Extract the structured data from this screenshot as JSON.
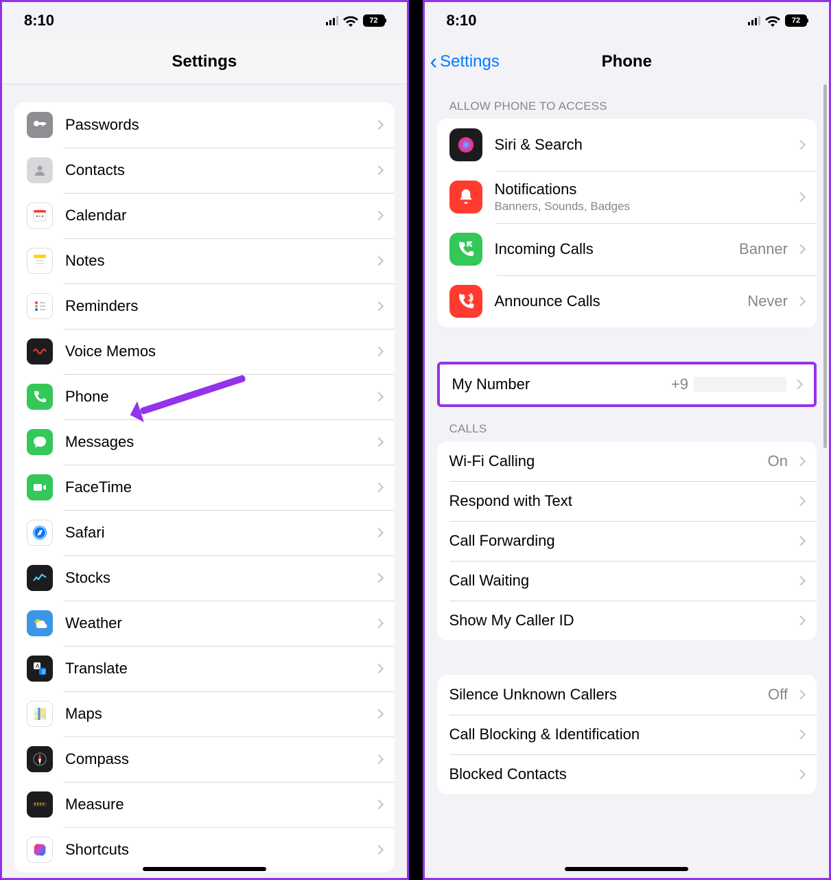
{
  "left": {
    "time": "8:10",
    "battery": "72",
    "title": "Settings",
    "items": [
      {
        "label": "Passwords",
        "icon": "key-icon",
        "bg": "#8e8e93"
      },
      {
        "label": "Contacts",
        "icon": "contacts-icon",
        "bg": "#d8d8dc"
      },
      {
        "label": "Calendar",
        "icon": "calendar-icon",
        "bg": "#ffffff"
      },
      {
        "label": "Notes",
        "icon": "notes-icon",
        "bg": "#ffffff"
      },
      {
        "label": "Reminders",
        "icon": "reminders-icon",
        "bg": "#ffffff"
      },
      {
        "label": "Voice Memos",
        "icon": "voice-memos-icon",
        "bg": "#1c1c1e"
      },
      {
        "label": "Phone",
        "icon": "phone-icon",
        "bg": "#34c759",
        "annotate": true
      },
      {
        "label": "Messages",
        "icon": "messages-icon",
        "bg": "#34c759"
      },
      {
        "label": "FaceTime",
        "icon": "facetime-icon",
        "bg": "#34c759"
      },
      {
        "label": "Safari",
        "icon": "safari-icon",
        "bg": "#ffffff"
      },
      {
        "label": "Stocks",
        "icon": "stocks-icon",
        "bg": "#1c1c1e"
      },
      {
        "label": "Weather",
        "icon": "weather-icon",
        "bg": "#3a97e8"
      },
      {
        "label": "Translate",
        "icon": "translate-icon",
        "bg": "#1c1c1e"
      },
      {
        "label": "Maps",
        "icon": "maps-icon",
        "bg": "#ffffff"
      },
      {
        "label": "Compass",
        "icon": "compass-icon",
        "bg": "#1c1c1e"
      },
      {
        "label": "Measure",
        "icon": "measure-icon",
        "bg": "#1c1c1e"
      },
      {
        "label": "Shortcuts",
        "icon": "shortcuts-icon",
        "bg": "#ffffff"
      }
    ]
  },
  "right": {
    "time": "8:10",
    "battery": "72",
    "back": "Settings",
    "title": "Phone",
    "access_header": "ALLOW PHONE TO ACCESS",
    "access": [
      {
        "label": "Siri & Search",
        "icon": "siri-icon",
        "bg": "#1c1c1e"
      },
      {
        "label": "Notifications",
        "sub": "Banners, Sounds, Badges",
        "icon": "bell-icon",
        "bg": "#ff3b30"
      },
      {
        "label": "Incoming Calls",
        "detail": "Banner",
        "icon": "incoming-icon",
        "bg": "#34c759"
      },
      {
        "label": "Announce Calls",
        "detail": "Never",
        "icon": "announce-icon",
        "bg": "#ff3b30"
      }
    ],
    "my_number": {
      "label": "My Number",
      "value": "+9"
    },
    "calls_header": "CALLS",
    "calls": [
      {
        "label": "Wi-Fi Calling",
        "detail": "On"
      },
      {
        "label": "Respond with Text"
      },
      {
        "label": "Call Forwarding"
      },
      {
        "label": "Call Waiting"
      },
      {
        "label": "Show My Caller ID"
      }
    ],
    "extra": [
      {
        "label": "Silence Unknown Callers",
        "detail": "Off"
      },
      {
        "label": "Call Blocking & Identification"
      },
      {
        "label": "Blocked Contacts"
      }
    ]
  },
  "icons": {
    "key-icon": "<svg viewBox='0 0 24 24' fill='white'><path d='M7 14a4 4 0 1 1 3.5-6l9 0 2 2-2 2h-2v2h-2v-2h-5A4 4 0 0 1 7 14z'/></svg>",
    "contacts-icon": "<svg viewBox='0 0 24 24'><circle cx='12' cy='9' r='3.5' fill='#9e9ea3'/><path d='M5 20c0-4 3-6 7-6s7 2 7 6z' fill='#9e9ea3'/></svg>",
    "calendar-icon": "<svg viewBox='0 0 24 24'><rect x='3' y='4' width='18' height='4' fill='#ff3b30' rx='2'/><rect x='3' y='8' width='18' height='12' fill='#fff' stroke='#ddd'/><circle cx='8' cy='13' r='1' fill='#333'/><circle cx='12' cy='13' r='1' fill='#ff3b30'/><circle cx='16' cy='13' r='1' fill='#333'/></svg>",
    "notes-icon": "<svg viewBox='0 0 24 24'><rect x='3' y='3' width='18' height='5' fill='#ffd60a'/><rect x='3' y='8' width='18' height='13' fill='#fff'/><line x1='6' y1='12' x2='18' y2='12' stroke='#ccc'/><line x1='6' y1='16' x2='18' y2='16' stroke='#ccc'/></svg>",
    "reminders-icon": "<svg viewBox='0 0 24 24'><circle cx='7' cy='7' r='2' fill='#ff3b30'/><circle cx='7' cy='12' r='2' fill='#ff9500'/><circle cx='7' cy='17' r='2' fill='#007aff'/><line x1='12' y1='7' x2='20' y2='7' stroke='#ccc' stroke-width='2'/><line x1='12' y1='12' x2='20' y2='12' stroke='#ccc' stroke-width='2'/><line x1='12' y1='17' x2='20' y2='17' stroke='#ccc' stroke-width='2'/></svg>",
    "voice-memos-icon": "<svg viewBox='0 0 24 24'><path d='M3 12q3-6 6 0t6 0q3-6 6 0' stroke='#ff3b30' stroke-width='2' fill='none'/></svg>",
    "phone-icon": "<svg viewBox='0 0 24 24' fill='white'><path d='M6 3c-1 0-2 1-2 2 0 8 7 15 15 15 1 0 2-1 2-2v-3l-4-1-2 2c-3-1-5-3-6-6l2-2-1-4H6z'/></svg>",
    "messages-icon": "<svg viewBox='0 0 24 24' fill='white'><path d='M12 4C7 4 3 7 3 11c0 2 1 4 3 5l-1 4 4-2c1 0 2 1 3 1 5 0 9-3 9-8s-4-7-9-7z'/></svg>",
    "facetime-icon": "<svg viewBox='0 0 24 24' fill='white'><rect x='3' y='7' width='12' height='10' rx='2'/><path d='M17 10l4-2v8l-4-2z'/></svg>",
    "safari-icon": "<svg viewBox='0 0 24 24'><circle cx='12' cy='12' r='10' fill='#007aff'/><circle cx='12' cy='12' r='9' fill='#fff'/><circle cx='12' cy='12' r='8' fill='#007aff'/><path d='M8 16l3-7 5-1-3 7z' fill='#fff'/><path d='M8 16l3-7 1 1-4 6z' fill='#ff3b30'/></svg>",
    "stocks-icon": "<svg viewBox='0 0 24 24'><path d='M3 16l4-5 3 3 5-7 6 4' stroke='#4cd5ff' stroke-width='2' fill='none'/></svg>",
    "weather-icon": "<svg viewBox='0 0 24 24'><circle cx='9' cy='10' r='4' fill='#ffcc00'/><path d='M7 14a4 4 0 0 1 4-4 5 5 0 0 1 9 3 3 3 0 0 1-1 6H9a4 4 0 0 1-2-5z' fill='#fff'/></svg>",
    "translate-icon": "<svg viewBox='0 0 24 24'><rect x='3' y='3' width='10' height='10' rx='2' fill='#fff'/><text x='6' y='11' font-size='8' fill='#000'>A</text><rect x='11' y='11' width='10' height='10' rx='2' fill='#0a84ff'/><text x='14' y='19' font-size='7' fill='#fff'>文</text></svg>",
    "maps-icon": "<svg viewBox='0 0 24 24'><path d='M3 3h18v18H3z' fill='#e8f5e9'/><path d='M3 12L21 3v18z' fill='#cce8b5'/><path d='M3 21L15 3l6 6-12 12z' fill='#ffe08a'/><path d='M11 3v18' stroke='#4a90e2' stroke-width='3'/></svg>",
    "compass-icon": "<svg viewBox='0 0 24 24'><circle cx='12' cy='12' r='9' stroke='#888' fill='none'/><path d='M12 4l2 8-2 8-2-8z' fill='#fff'/><path d='M12 4l2 8h-4z' fill='#ff3b30'/></svg>",
    "measure-icon": "<svg viewBox='0 0 24 24'><rect x='2' y='9' width='20' height='6' fill='#333' rx='1'/><line x1='5' y1='9' x2='5' y2='13' stroke='#ffcc00'/><line x1='9' y1='9' x2='9' y2='13' stroke='#ffcc00'/><line x1='13' y1='9' x2='13' y2='13' stroke='#ffcc00'/><line x1='17' y1='9' x2='17' y2='13' stroke='#ffcc00'/></svg>",
    "shortcuts-icon": "<svg viewBox='0 0 24 24'><defs><linearGradient id='sg' x1='0' y1='0' x2='1' y2='1'><stop offset='0' stop-color='#ff2d55'/><stop offset='0.5' stop-color='#af52de'/><stop offset='1' stop-color='#007aff'/></linearGradient></defs><rect x='4' y='4' width='16' height='16' rx='4' fill='url(#sg)' transform='rotate(10 12 12)'/><rect x='4' y='4' width='16' height='16' rx='4' fill='url(#sg)' opacity='0.7' transform='rotate(-10 12 12)'/></svg>",
    "siri-icon": "<svg viewBox='0 0 24 24'><defs><radialGradient id='sr'><stop offset='0' stop-color='#5ac8fa'/><stop offset='0.5' stop-color='#af52de'/><stop offset='1' stop-color='#ff2d55'/></radialGradient></defs><circle cx='12' cy='12' r='9' fill='url(#sr)'/></svg>",
    "bell-icon": "<svg viewBox='0 0 24 24' fill='white'><path d='M12 3a5 5 0 0 0-5 5v4l-2 3h14l-2-3V8a5 5 0 0 0-5-5zM10 18a2 2 0 0 0 4 0z'/></svg>",
    "incoming-icon": "<svg viewBox='0 0 24 24' fill='white'><path d='M6 3c-1 0-2 1-2 2 0 8 7 15 15 15 1 0 2-1 2-2v-3l-4-1-2 2c-3-1-5-3-6-6l2-2-1-4H6z'/><path d='M14 4l5 5M14 9V4h5' stroke='white' stroke-width='2' fill='none'/></svg>",
    "announce-icon": "<svg viewBox='0 0 24 24' fill='white'><path d='M6 3c-1 0-2 1-2 2 0 8 7 15 15 15 1 0 2-1 2-2v-3l-4-1-2 2c-3-1-5-3-6-6l2-2-1-4H6z'/><path d='M15 5a3 3 0 0 1 0 6M17 3a6 6 0 0 1 0 10' stroke='white' stroke-width='1.5' fill='none'/></svg>"
  }
}
